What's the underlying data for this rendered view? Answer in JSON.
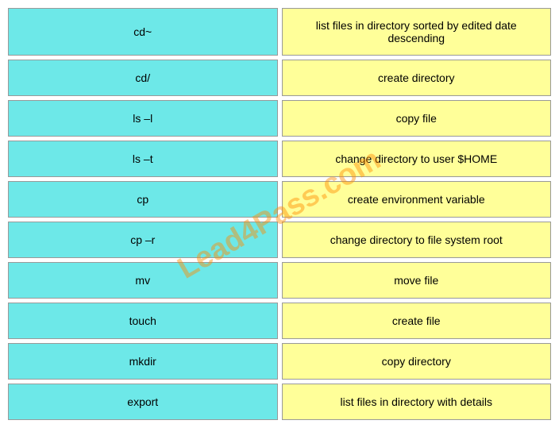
{
  "watermark": "Lead4Pass.com",
  "rows": [
    {
      "command": "cd~",
      "description": "list files in directory sorted by edited date descending",
      "desc_tall": true
    },
    {
      "command": "cd/",
      "description": "create directory",
      "desc_tall": false
    },
    {
      "command": "ls –l",
      "description": "copy file",
      "desc_tall": false
    },
    {
      "command": "ls –t",
      "description": "change directory to user $HOME",
      "desc_tall": false
    },
    {
      "command": "cp",
      "description": "create environment variable",
      "desc_tall": false
    },
    {
      "command": "cp –r",
      "description": "change directory to file system root",
      "desc_tall": false
    },
    {
      "command": "mv",
      "description": "move file",
      "desc_tall": false
    },
    {
      "command": "touch",
      "description": "create file",
      "desc_tall": false
    },
    {
      "command": "mkdir",
      "description": "copy directory",
      "desc_tall": false
    },
    {
      "command": "export",
      "description": "list files in directory with details",
      "desc_tall": false
    }
  ]
}
